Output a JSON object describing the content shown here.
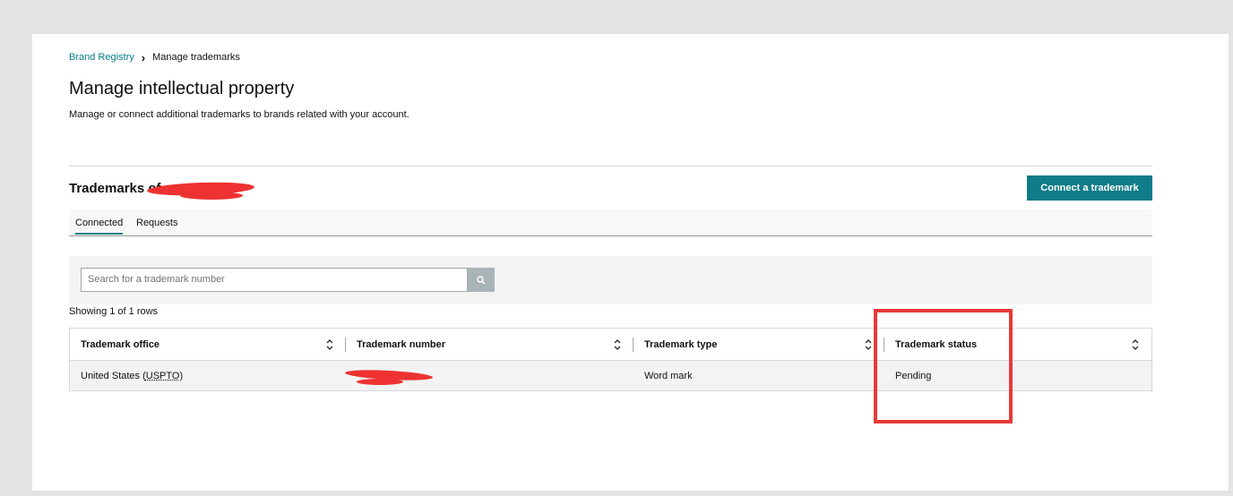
{
  "breadcrumb": {
    "root": "Brand Registry",
    "current": "Manage trademarks"
  },
  "page": {
    "title": "Manage intellectual property",
    "subtitle": "Manage or connect additional trademarks to brands related with your account."
  },
  "section": {
    "title": "Trademarks of",
    "connect_button": "Connect a trademark"
  },
  "tabs": [
    {
      "label": "Connected",
      "active": true
    },
    {
      "label": "Requests",
      "active": false
    }
  ],
  "search": {
    "placeholder": "Search for a trademark number",
    "icon": "search-icon"
  },
  "showing": "Showing 1 of 1 rows",
  "table": {
    "columns": [
      "Trademark office",
      "Trademark number",
      "Trademark type",
      "Trademark status"
    ],
    "rows": [
      {
        "office_prefix": "United States (",
        "office_link": "USPTO",
        "office_suffix": ")",
        "number": "",
        "type": "Word mark",
        "status": "Pending"
      }
    ]
  },
  "colors": {
    "accent": "#0f7c89",
    "link": "#067d8a",
    "annotation": "#e83a3a"
  }
}
